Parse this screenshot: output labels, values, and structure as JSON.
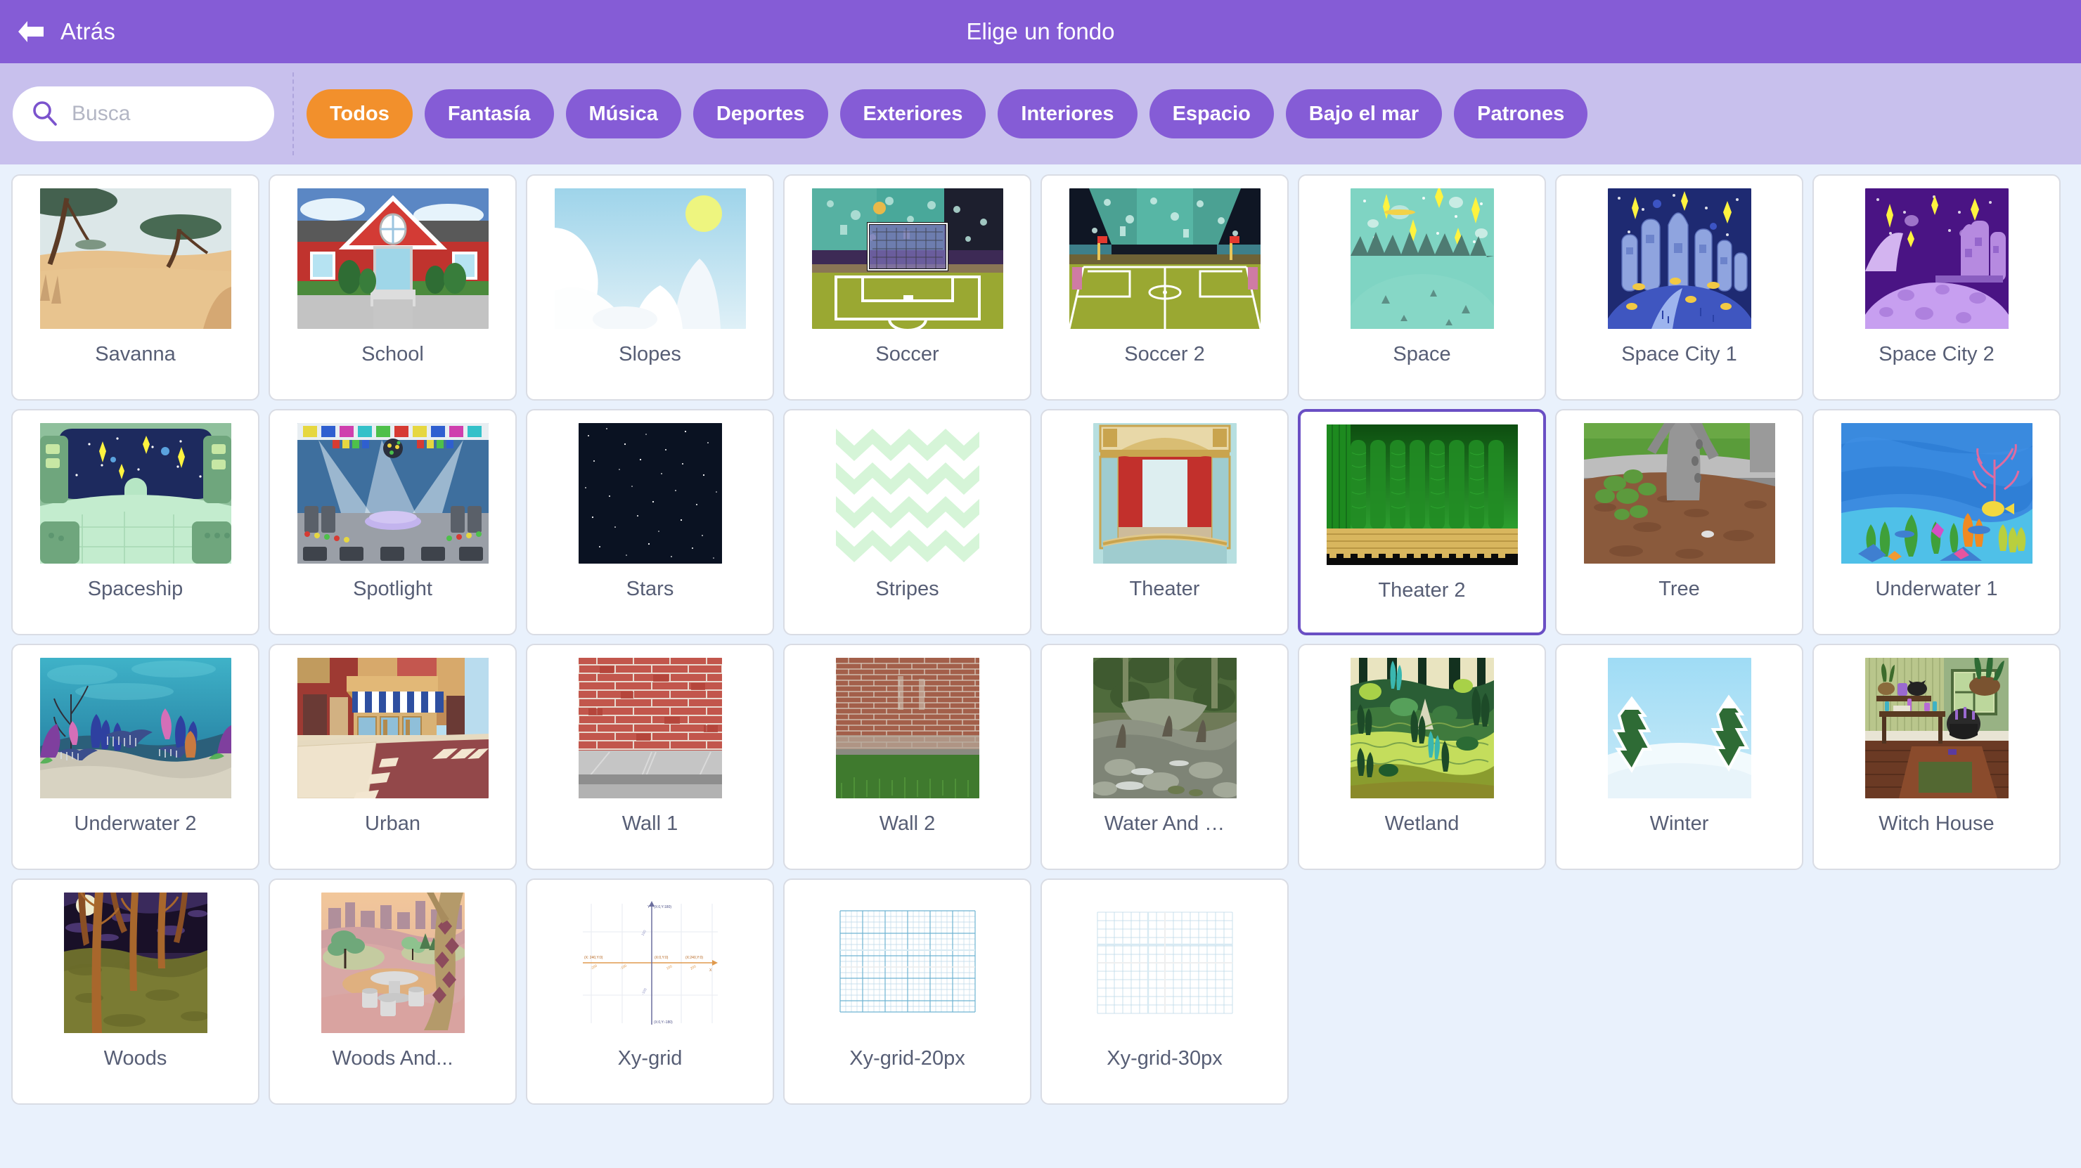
{
  "header": {
    "back_label": "Atrás",
    "back_icon": "arrow-left-icon",
    "title": "Elige un fondo",
    "bg_color": "#855cd6"
  },
  "search": {
    "icon": "search-icon",
    "placeholder": "Busca",
    "value": ""
  },
  "filters": {
    "bar_color": "#c8c0ed",
    "active_color": "#f2902c",
    "inactive_color": "#855cd6",
    "tags": [
      {
        "label": "Todos",
        "active": true
      },
      {
        "label": "Fantasía",
        "active": false
      },
      {
        "label": "Música",
        "active": false
      },
      {
        "label": "Deportes",
        "active": false
      },
      {
        "label": "Exteriores",
        "active": false
      },
      {
        "label": "Interiores",
        "active": false
      },
      {
        "label": "Espacio",
        "active": false
      },
      {
        "label": "Bajo el mar",
        "active": false
      },
      {
        "label": "Patrones",
        "active": false
      }
    ]
  },
  "grid": {
    "selected_label": "Theater 2",
    "selected_border_color": "#6a4fc4",
    "page_bg": "#e9f1fc",
    "items": [
      {
        "label": "Savanna",
        "thumb": "savanna"
      },
      {
        "label": "School",
        "thumb": "school"
      },
      {
        "label": "Slopes",
        "thumb": "slopes"
      },
      {
        "label": "Soccer",
        "thumb": "soccer"
      },
      {
        "label": "Soccer 2",
        "thumb": "soccer2"
      },
      {
        "label": "Space",
        "thumb": "space"
      },
      {
        "label": "Space City 1",
        "thumb": "spacecity1"
      },
      {
        "label": "Space City 2",
        "thumb": "spacecity2"
      },
      {
        "label": "Spaceship",
        "thumb": "spaceship"
      },
      {
        "label": "Spotlight",
        "thumb": "spotlight"
      },
      {
        "label": "Stars",
        "thumb": "stars"
      },
      {
        "label": "Stripes",
        "thumb": "stripes"
      },
      {
        "label": "Theater",
        "thumb": "theater"
      },
      {
        "label": "Theater 2",
        "thumb": "theater2"
      },
      {
        "label": "Tree",
        "thumb": "tree"
      },
      {
        "label": "Underwater 1",
        "thumb": "underwater1"
      },
      {
        "label": "Underwater 2",
        "thumb": "underwater2"
      },
      {
        "label": "Urban",
        "thumb": "urban"
      },
      {
        "label": "Wall 1",
        "thumb": "wall1"
      },
      {
        "label": "Wall 2",
        "thumb": "wall2"
      },
      {
        "label": "Water And …",
        "thumb": "waterand"
      },
      {
        "label": "Wetland",
        "thumb": "wetland"
      },
      {
        "label": "Winter",
        "thumb": "winter"
      },
      {
        "label": "Witch House",
        "thumb": "witchhouse"
      },
      {
        "label": "Woods",
        "thumb": "woods"
      },
      {
        "label": "Woods And...",
        "thumb": "woodsand"
      },
      {
        "label": "Xy-grid",
        "thumb": "xygrid"
      },
      {
        "label": "Xy-grid-20px",
        "thumb": "xygrid20"
      },
      {
        "label": "Xy-grid-30px",
        "thumb": "xygrid30"
      }
    ]
  }
}
